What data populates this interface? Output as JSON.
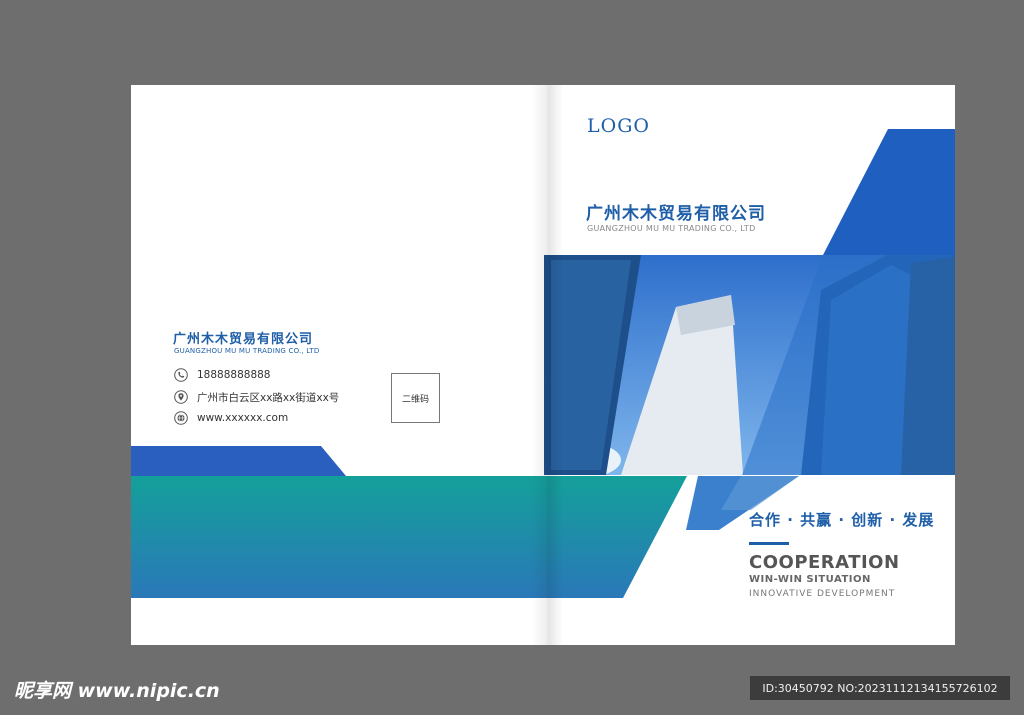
{
  "front": {
    "logo": "LOGO",
    "company_cn": "广州木木贸易有限公司",
    "company_en": "GUANGZHOU MU MU TRADING CO., LTD",
    "slogan_cn": "合作 · 共赢 · 创新 · 发展",
    "slogan_en_1": "COOPERATION",
    "slogan_en_2": "WIN-WIN SITUATION",
    "slogan_en_3": "INNOVATIVE  DEVELOPMENT"
  },
  "back": {
    "company_cn": "广州木木贸易有限公司",
    "company_en": "GUANGZHOU MU MU TRADING CO., LTD",
    "contacts": [
      {
        "icon": "phone-icon",
        "text": "18888888888"
      },
      {
        "icon": "location-icon",
        "text": "广州市白云区xx路xx街道xx号"
      },
      {
        "icon": "globe-icon",
        "text": "www.xxxxxx.com"
      }
    ],
    "qr_label": "二维码"
  },
  "watermark": {
    "site": "昵享网 www.nipic.cn",
    "id": "ID:30450792 NO:20231112134155726102"
  },
  "colors": {
    "blue": "#1f5fa8",
    "teal": "#16999a",
    "sky": "#3a86d8"
  }
}
